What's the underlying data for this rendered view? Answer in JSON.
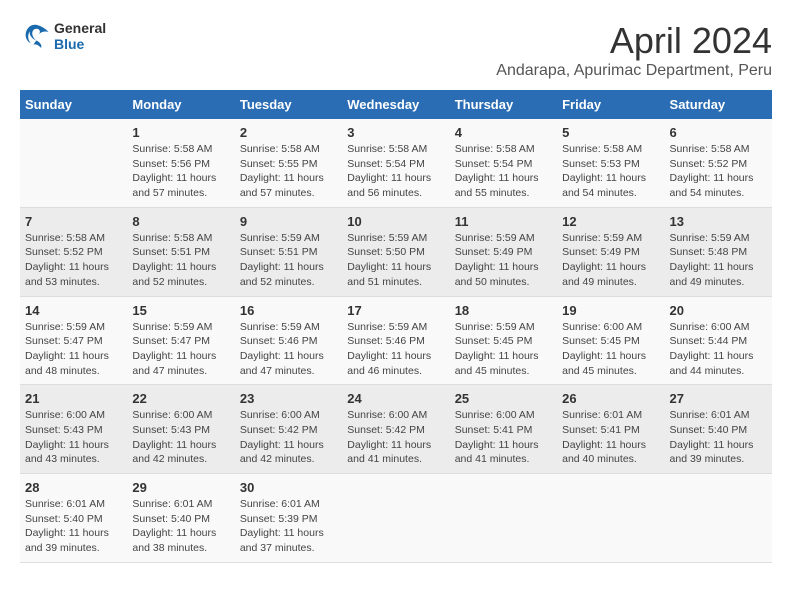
{
  "header": {
    "logo_line1": "General",
    "logo_line2": "Blue",
    "title": "April 2024",
    "subtitle": "Andarapa, Apurimac Department, Peru"
  },
  "calendar": {
    "headers": [
      "Sunday",
      "Monday",
      "Tuesday",
      "Wednesday",
      "Thursday",
      "Friday",
      "Saturday"
    ],
    "weeks": [
      [
        {
          "day": "",
          "content": ""
        },
        {
          "day": "1",
          "content": "Sunrise: 5:58 AM\nSunset: 5:56 PM\nDaylight: 11 hours\nand 57 minutes."
        },
        {
          "day": "2",
          "content": "Sunrise: 5:58 AM\nSunset: 5:55 PM\nDaylight: 11 hours\nand 57 minutes."
        },
        {
          "day": "3",
          "content": "Sunrise: 5:58 AM\nSunset: 5:54 PM\nDaylight: 11 hours\nand 56 minutes."
        },
        {
          "day": "4",
          "content": "Sunrise: 5:58 AM\nSunset: 5:54 PM\nDaylight: 11 hours\nand 55 minutes."
        },
        {
          "day": "5",
          "content": "Sunrise: 5:58 AM\nSunset: 5:53 PM\nDaylight: 11 hours\nand 54 minutes."
        },
        {
          "day": "6",
          "content": "Sunrise: 5:58 AM\nSunset: 5:52 PM\nDaylight: 11 hours\nand 54 minutes."
        }
      ],
      [
        {
          "day": "7",
          "content": "Sunrise: 5:58 AM\nSunset: 5:52 PM\nDaylight: 11 hours\nand 53 minutes."
        },
        {
          "day": "8",
          "content": "Sunrise: 5:58 AM\nSunset: 5:51 PM\nDaylight: 11 hours\nand 52 minutes."
        },
        {
          "day": "9",
          "content": "Sunrise: 5:59 AM\nSunset: 5:51 PM\nDaylight: 11 hours\nand 52 minutes."
        },
        {
          "day": "10",
          "content": "Sunrise: 5:59 AM\nSunset: 5:50 PM\nDaylight: 11 hours\nand 51 minutes."
        },
        {
          "day": "11",
          "content": "Sunrise: 5:59 AM\nSunset: 5:49 PM\nDaylight: 11 hours\nand 50 minutes."
        },
        {
          "day": "12",
          "content": "Sunrise: 5:59 AM\nSunset: 5:49 PM\nDaylight: 11 hours\nand 49 minutes."
        },
        {
          "day": "13",
          "content": "Sunrise: 5:59 AM\nSunset: 5:48 PM\nDaylight: 11 hours\nand 49 minutes."
        }
      ],
      [
        {
          "day": "14",
          "content": "Sunrise: 5:59 AM\nSunset: 5:47 PM\nDaylight: 11 hours\nand 48 minutes."
        },
        {
          "day": "15",
          "content": "Sunrise: 5:59 AM\nSunset: 5:47 PM\nDaylight: 11 hours\nand 47 minutes."
        },
        {
          "day": "16",
          "content": "Sunrise: 5:59 AM\nSunset: 5:46 PM\nDaylight: 11 hours\nand 47 minutes."
        },
        {
          "day": "17",
          "content": "Sunrise: 5:59 AM\nSunset: 5:46 PM\nDaylight: 11 hours\nand 46 minutes."
        },
        {
          "day": "18",
          "content": "Sunrise: 5:59 AM\nSunset: 5:45 PM\nDaylight: 11 hours\nand 45 minutes."
        },
        {
          "day": "19",
          "content": "Sunrise: 6:00 AM\nSunset: 5:45 PM\nDaylight: 11 hours\nand 45 minutes."
        },
        {
          "day": "20",
          "content": "Sunrise: 6:00 AM\nSunset: 5:44 PM\nDaylight: 11 hours\nand 44 minutes."
        }
      ],
      [
        {
          "day": "21",
          "content": "Sunrise: 6:00 AM\nSunset: 5:43 PM\nDaylight: 11 hours\nand 43 minutes."
        },
        {
          "day": "22",
          "content": "Sunrise: 6:00 AM\nSunset: 5:43 PM\nDaylight: 11 hours\nand 42 minutes."
        },
        {
          "day": "23",
          "content": "Sunrise: 6:00 AM\nSunset: 5:42 PM\nDaylight: 11 hours\nand 42 minutes."
        },
        {
          "day": "24",
          "content": "Sunrise: 6:00 AM\nSunset: 5:42 PM\nDaylight: 11 hours\nand 41 minutes."
        },
        {
          "day": "25",
          "content": "Sunrise: 6:00 AM\nSunset: 5:41 PM\nDaylight: 11 hours\nand 41 minutes."
        },
        {
          "day": "26",
          "content": "Sunrise: 6:01 AM\nSunset: 5:41 PM\nDaylight: 11 hours\nand 40 minutes."
        },
        {
          "day": "27",
          "content": "Sunrise: 6:01 AM\nSunset: 5:40 PM\nDaylight: 11 hours\nand 39 minutes."
        }
      ],
      [
        {
          "day": "28",
          "content": "Sunrise: 6:01 AM\nSunset: 5:40 PM\nDaylight: 11 hours\nand 39 minutes."
        },
        {
          "day": "29",
          "content": "Sunrise: 6:01 AM\nSunset: 5:40 PM\nDaylight: 11 hours\nand 38 minutes."
        },
        {
          "day": "30",
          "content": "Sunrise: 6:01 AM\nSunset: 5:39 PM\nDaylight: 11 hours\nand 37 minutes."
        },
        {
          "day": "",
          "content": ""
        },
        {
          "day": "",
          "content": ""
        },
        {
          "day": "",
          "content": ""
        },
        {
          "day": "",
          "content": ""
        }
      ]
    ]
  }
}
